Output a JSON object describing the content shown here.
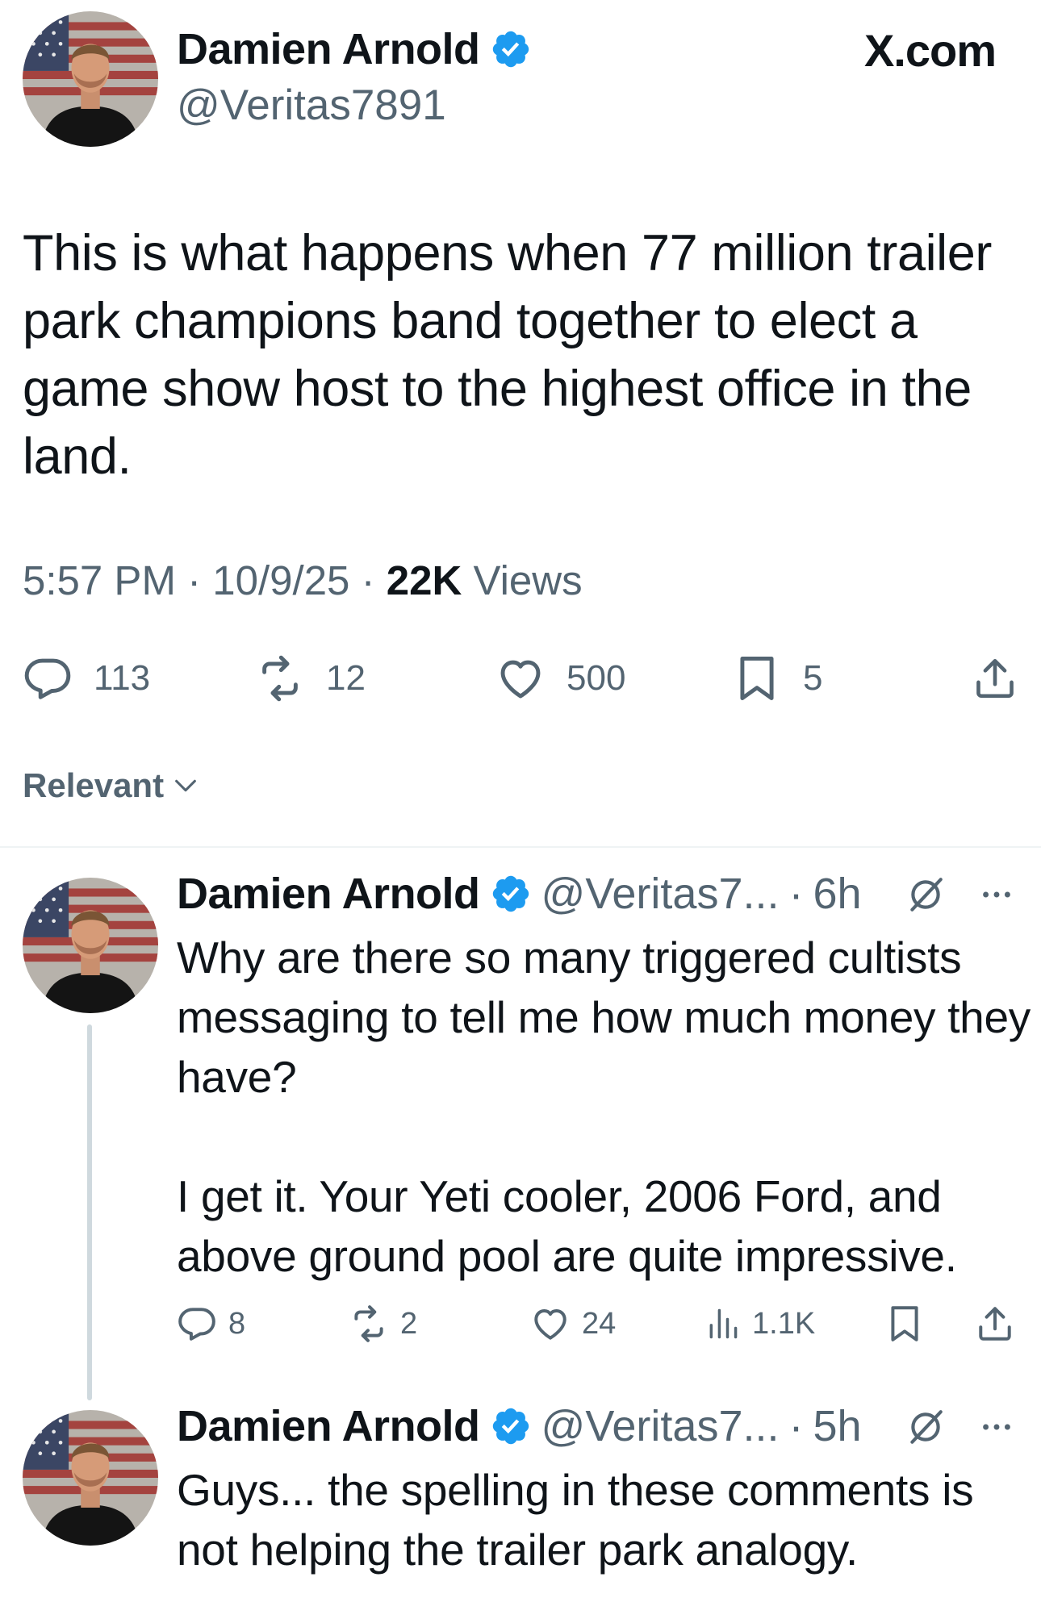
{
  "brand": {
    "label": "X.com"
  },
  "main_tweet": {
    "author_name": "Damien Arnold",
    "author_handle": "@Veritas7891",
    "verified": true,
    "text": "This is what happens when 77 million trailer park champions band together to elect a game show host to the highest office in the land.",
    "time": "5:57 PM",
    "date": "10/9/25",
    "sep": "·",
    "views_count": "22K",
    "views_label": "Views",
    "replies": "113",
    "reposts": "12",
    "likes": "500",
    "bookmarks": "5"
  },
  "sort": {
    "label": "Relevant"
  },
  "replies": [
    {
      "author_name": "Damien Arnold",
      "author_handle": "@Veritas7...",
      "sep": "·",
      "time": "6h",
      "verified": true,
      "paragraph1": "Why are there so many triggered cultists messaging to tell me how much money they have?",
      "paragraph2": "I get it. Your Yeti cooler, 2006 Ford, and above ground pool are quite impressive.",
      "replies": "8",
      "reposts": "2",
      "likes": "24",
      "views": "1.1K"
    },
    {
      "author_name": "Damien Arnold",
      "author_handle": "@Veritas7...",
      "sep": "·",
      "time": "5h",
      "verified": true,
      "text": "Guys... the spelling in these comments is not helping the trailer park analogy."
    }
  ],
  "colors": {
    "text_primary": "#0f1419",
    "text_secondary": "#536471",
    "verified_blue": "#1d9bf0",
    "divider": "#eff3f4",
    "thread_line": "#cfd9de"
  },
  "icons": [
    "avatar",
    "verified-badge-icon",
    "reply-icon",
    "repost-icon",
    "like-icon",
    "bookmark-icon",
    "share-icon",
    "views-icon",
    "chevron-down-icon",
    "grok-icon",
    "more-icon"
  ]
}
